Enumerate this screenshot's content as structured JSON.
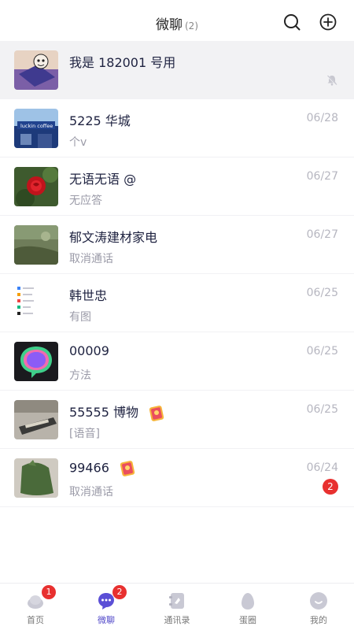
{
  "header": {
    "title": "微聊",
    "count": "(2)"
  },
  "chats": [
    {
      "name": "我是 182001 号用",
      "preview": "",
      "date": "",
      "unread": "",
      "muted": true,
      "pinned": true,
      "sticker": false
    },
    {
      "name": "5225 华城",
      "preview": "个v",
      "date": "06/28",
      "unread": "",
      "muted": false,
      "pinned": false,
      "sticker": false
    },
    {
      "name": "无语无语 @",
      "preview": "无应答",
      "date": "06/27",
      "unread": "",
      "muted": false,
      "pinned": false,
      "sticker": false
    },
    {
      "name": "郁文涛建材家电",
      "preview": "取消通话",
      "date": "06/27",
      "unread": "",
      "muted": false,
      "pinned": false,
      "sticker": false
    },
    {
      "name": "韩世忠",
      "preview": "有图",
      "date": "06/25",
      "unread": "",
      "muted": false,
      "pinned": false,
      "sticker": false
    },
    {
      "name": "00009",
      "preview": "方法",
      "date": "06/25",
      "unread": "",
      "muted": false,
      "pinned": false,
      "sticker": false
    },
    {
      "name": "55555 博物",
      "preview": "[语音]",
      "date": "06/25",
      "unread": "",
      "muted": false,
      "pinned": false,
      "sticker": true
    },
    {
      "name": "99466",
      "preview": "取消通话",
      "date": "06/24",
      "unread": "2",
      "muted": false,
      "pinned": false,
      "sticker": true
    }
  ],
  "tabbar": {
    "items": [
      {
        "label": "首页",
        "badge": "1",
        "icon": "home-icon",
        "active": false
      },
      {
        "label": "微聊",
        "badge": "2",
        "icon": "chat-bubble-icon",
        "active": true
      },
      {
        "label": "通讯录",
        "badge": "",
        "icon": "contacts-icon",
        "active": false
      },
      {
        "label": "蛋圈",
        "badge": "",
        "icon": "egg-icon",
        "active": false
      },
      {
        "label": "我的",
        "badge": "",
        "icon": "profile-icon",
        "active": false
      }
    ]
  },
  "colors": {
    "accent": "#4f46c8",
    "badge": "#e8302f",
    "title": "#1e2240",
    "secondary": "#9b9ba8",
    "pinned_bg": "#f2f2f4"
  }
}
